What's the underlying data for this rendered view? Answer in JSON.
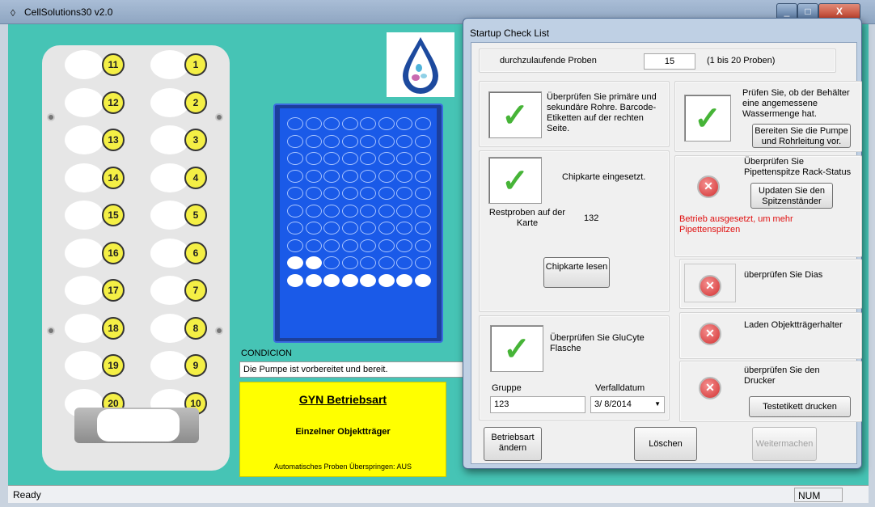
{
  "window": {
    "title": "CellSolutions30 v2.0",
    "close_glyph": "X",
    "min_glyph": "_",
    "max_glyph": "□"
  },
  "rack": {
    "right_column": [
      "1",
      "2",
      "3",
      "4",
      "5",
      "6",
      "7",
      "8",
      "9",
      "10"
    ],
    "left_column": [
      "11",
      "12",
      "13",
      "14",
      "15",
      "16",
      "17",
      "18",
      "19",
      "20"
    ]
  },
  "plate": {
    "rows": 10,
    "cols": 8,
    "filled_row9": 2,
    "filled_row10": 8
  },
  "condicion": {
    "label": "CONDICION",
    "text": "Die Pumpe ist vorbereitet und bereit."
  },
  "mode": {
    "title": "GYN Betriebsart",
    "subtitle": "Einzelner Objektträger",
    "auto_skip": "Automatisches Proben Überspringen: AUS"
  },
  "status": {
    "ready": "Ready",
    "num": "NUM"
  },
  "dialog": {
    "title": "Startup Check List",
    "samples_label": "durchzulaufende Proben",
    "samples_value": "15",
    "samples_range": "(1 bis 20 Proben)",
    "check_tubes": "Überprüfen Sie primäre und sekundäre Rohre. Barcode-Etiketten auf der rechten Seite.",
    "chip_inserted": "Chipkarte eingesetzt.",
    "rest_label": "Restproben auf der Karte",
    "rest_value": "132",
    "read_chip_btn": "Chipkarte lesen",
    "glucyte": "Überprüfen Sie GluCyte Flasche",
    "gruppe_label": "Gruppe",
    "gruppe_value": "123",
    "expiry_label": "Verfalldatum",
    "expiry_value": "3/ 8/2014",
    "water_check": "Prüfen Sie, ob der Behälter eine angemessene Wassermenge hat.",
    "prepare_pump_btn": "Bereiten Sie die Pumpe und Rohrleitung vor.",
    "tip_rack_check": "Überprüfen Sie Pipettenspitze Rack-Status",
    "update_tip_btn": "Updaten Sie den Spitzenständer",
    "tip_warning": "Betrieb ausgesetzt, um mehr Pipettenspitzen",
    "check_slides": "überprüfen Sie Dias",
    "load_holder": "Laden Objektträgerhalter",
    "check_printer": "überprüfen Sie den Drucker",
    "test_label_btn": "Testetikett drucken",
    "change_mode_btn": "Betriebsart ändern",
    "clear_btn": "Löschen",
    "continue_btn": "Weitermachen",
    "check_glyph": "✓",
    "x_glyph": "✕",
    "dropdown_glyph": "▼"
  },
  "colors": {
    "client_bg": "#46c4b5",
    "accent_yellow": "#ffff00",
    "check_green": "#46b437",
    "warning_red": "#e01010"
  }
}
